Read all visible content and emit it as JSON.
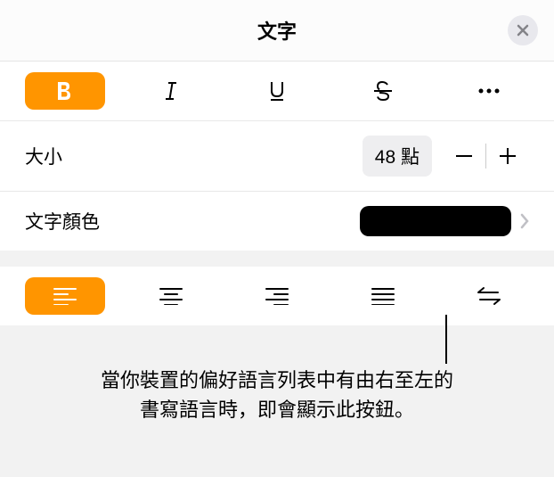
{
  "header": {
    "title": "文字"
  },
  "format": {
    "bold_active": true
  },
  "size": {
    "label": "大小",
    "value": "48 點"
  },
  "color": {
    "label": "文字顏色",
    "value": "#000000"
  },
  "align": {
    "active": "left"
  },
  "callout": {
    "line1": "當你裝置的偏好語言列表中有由右至左的",
    "line2": "書寫語言時，即會顯示此按鈕。"
  }
}
